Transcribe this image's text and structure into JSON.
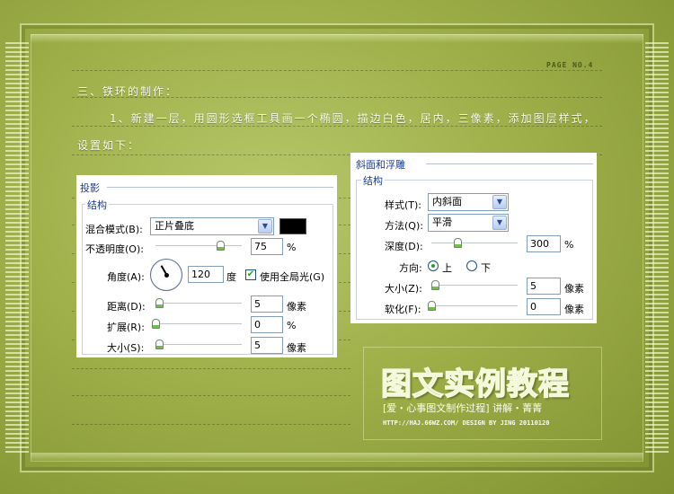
{
  "page": {
    "page_no": "PAGE NO.4",
    "section_heading": "三、铁环的制作：",
    "step_line1": "1、新建一层，用圆形选框工具画一个椭圆，描边白色，居内，三像素，添加图层样式，",
    "step_line2": "设置如下："
  },
  "drop_shadow": {
    "title": "投影",
    "group": "结构",
    "blend_mode_label": "混合模式(B):",
    "blend_mode_value": "正片叠底",
    "shadow_color": "#000000",
    "opacity_label": "不透明度(O):",
    "opacity_value": "75",
    "opacity_unit": "%",
    "opacity_level": 0.75,
    "angle_label": "角度(A):",
    "angle_value": "120",
    "angle_unit": "度",
    "global_light_label": "使用全局光(G)",
    "global_light_checked": true,
    "distance_label": "距离(D):",
    "distance_value": "5",
    "distance_unit": "像素",
    "spread_label": "扩展(R):",
    "spread_value": "0",
    "spread_unit": "%",
    "size_label": "大小(S):",
    "size_value": "5",
    "size_unit": "像素"
  },
  "bevel": {
    "title": "斜面和浮雕",
    "group": "结构",
    "style_label": "样式(T):",
    "style_value": "内斜面",
    "technique_label": "方法(Q):",
    "technique_value": "平滑",
    "depth_label": "深度(D):",
    "depth_value": "300",
    "depth_unit": "%",
    "direction_label": "方向:",
    "direction_up": "上",
    "direction_down": "下",
    "direction_selected": "上",
    "size_label": "大小(Z):",
    "size_value": "5",
    "size_unit": "像素",
    "soften_label": "软化(F):",
    "soften_value": "0",
    "soften_unit": "像素"
  },
  "logo": {
    "title": "图文实例教程",
    "subtitle": "[爱・心事图文制作过程]  讲解・菁菁",
    "credit": "HTTP://HAJ.66WZ.COM/  DESIGN BY JING  20110120"
  },
  "colors": {
    "background": "#9fb04a",
    "panel_title": "#1a3c9c",
    "text_light": "#fbfdea"
  }
}
